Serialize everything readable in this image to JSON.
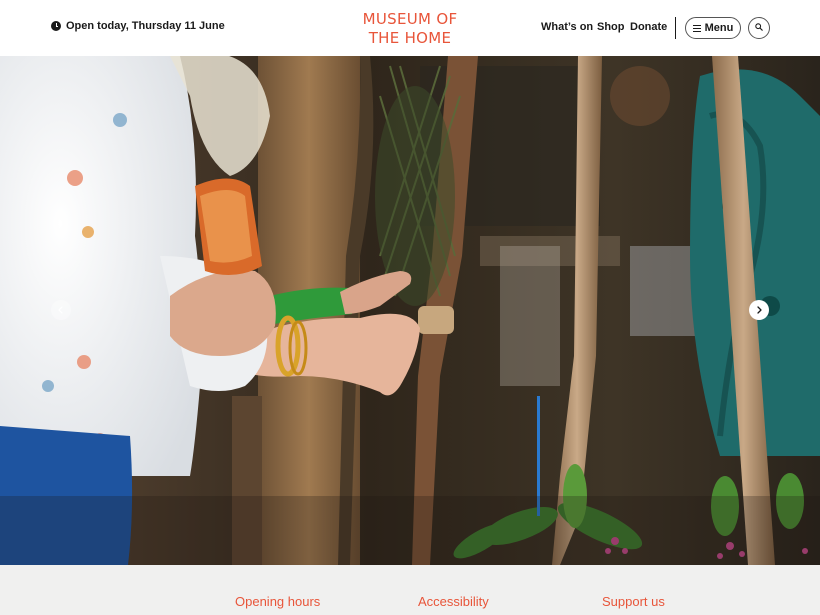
{
  "header": {
    "open_today": "Open today, Thursday 11 June",
    "logo_line1": "MUSEUM OF",
    "logo_line2": "THE HOME",
    "nav": {
      "whats_on": "What’s on",
      "shop": "Shop",
      "donate": "Donate"
    },
    "menu_label": "Menu"
  },
  "icons": {
    "clock": "clock-icon",
    "menu": "burger-icon",
    "search": "search-icon",
    "prev": "chevron-left-icon",
    "next": "chevron-right-icon"
  },
  "colors": {
    "brand": "#e8553a",
    "footer_bg": "#f0f0ef",
    "text": "#1a1a1a"
  },
  "footer": {
    "links": [
      "Opening hours",
      "Accessibility",
      "Support us"
    ]
  }
}
